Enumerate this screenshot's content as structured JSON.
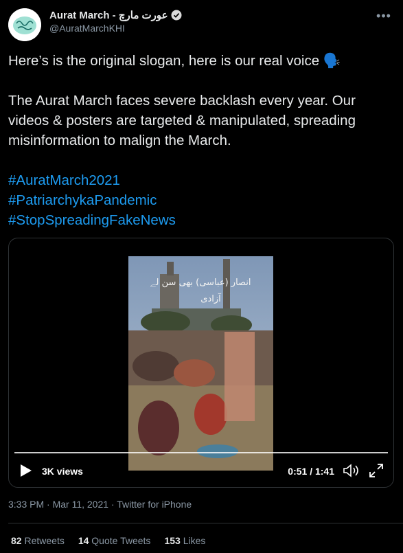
{
  "account": {
    "display_name": "Aurat March - عورت مارچ",
    "handle": "@AuratMarchKHI",
    "verified_icon": "verified-badge-icon",
    "more_icon": "more-options-icon"
  },
  "tweet": {
    "line1": "Here’s is the original slogan, here is our real voice 🗣️",
    "paragraph2": "The Aurat March faces severe backlash every year. Our videos & posters are targeted & manipulated, spreading misinformation to malign the March.",
    "hashtags": [
      "#AuratMarch2021",
      "#PatriarchykaPandemic",
      "#StopSpreadingFakeNews"
    ]
  },
  "video": {
    "views": "3K views",
    "time": "0:51 / 1:41",
    "progress_fraction": 0.51
  },
  "meta": {
    "timestamp": "3:33 PM · Mar 11, 2021 · Twitter for iPhone"
  },
  "stats": {
    "retweets_count": "82",
    "retweets_label": "Retweets",
    "quotes_count": "14",
    "quotes_label": "Quote Tweets",
    "likes_count": "153",
    "likes_label": "Likes"
  },
  "colors": {
    "background": "#000000",
    "link": "#1d9bf0",
    "muted": "#8b98a5"
  }
}
